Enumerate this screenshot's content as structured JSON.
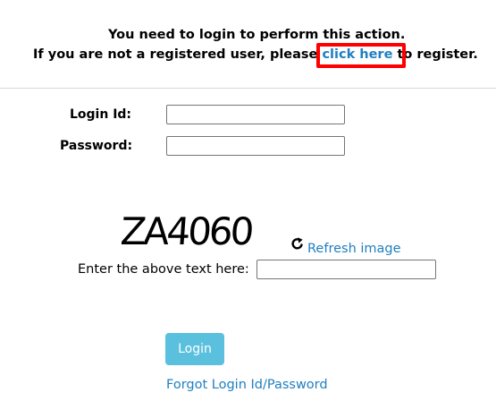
{
  "notice": {
    "line1": "You need to login to perform this action.",
    "line2_before": "If you are not a registered user, please ",
    "register_link": "click here",
    "line2_after": " to register."
  },
  "form": {
    "login_label": "Login Id:",
    "login_value": "",
    "password_label": "Password:",
    "password_value": ""
  },
  "captcha": {
    "image_text": "ZA4060",
    "refresh_label": "Refresh image",
    "prompt": "Enter the above text here:",
    "value": ""
  },
  "actions": {
    "login_button": "Login",
    "forgot_link": "Forgot Login Id/Password"
  },
  "colors": {
    "link": "#1f7fc0",
    "button": "#5bc0de",
    "highlight": "#ff0000"
  },
  "icons": {
    "refresh": "refresh-icon"
  }
}
